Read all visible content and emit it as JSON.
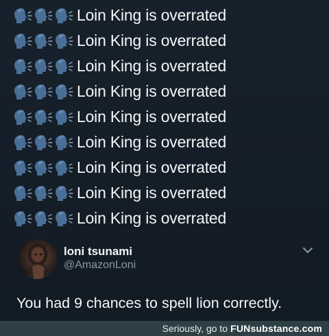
{
  "tweet": {
    "lines": [
      {
        "emojis": [
          "speaking-head-icon",
          "speaking-head-icon",
          "speaking-head-icon"
        ],
        "text": "Loin King is overrated"
      },
      {
        "emojis": [
          "speaking-head-icon",
          "speaking-head-icon",
          "speaking-head-icon"
        ],
        "text": "Loin King is overrated"
      },
      {
        "emojis": [
          "speaking-head-icon",
          "speaking-head-icon",
          "speaking-head-icon"
        ],
        "text": "Loin King is overrated"
      },
      {
        "emojis": [
          "speaking-head-icon",
          "speaking-head-icon",
          "speaking-head-icon"
        ],
        "text": "Loin King is overrated"
      },
      {
        "emojis": [
          "speaking-head-icon",
          "speaking-head-icon",
          "speaking-head-icon"
        ],
        "text": "Loin King is overrated"
      },
      {
        "emojis": [
          "speaking-head-icon",
          "speaking-head-icon",
          "speaking-head-icon"
        ],
        "text": "Loin King is overrated"
      },
      {
        "emojis": [
          "speaking-head-icon",
          "speaking-head-icon",
          "speaking-head-icon"
        ],
        "text": "Loin King is overrated"
      },
      {
        "emojis": [
          "speaking-head-icon",
          "speaking-head-icon",
          "speaking-head-icon"
        ],
        "text": "Loin King is overrated"
      },
      {
        "emojis": [
          "speaking-head-icon",
          "speaking-head-icon",
          "speaking-head-icon"
        ],
        "text": "Loin King is overrated"
      }
    ]
  },
  "reply": {
    "display_name": "loni tsunami",
    "handle": "@AmazonLoni",
    "text": "You had 9 chances to spell lion correctly.",
    "menu_icon": "chevron-down-icon"
  },
  "footer": {
    "prefix": "Seriously, go to",
    "brand_fun": "FUN",
    "brand_rest": "substance.com"
  },
  "colors": {
    "background": "#141d26",
    "text": "#f4f6f8",
    "muted": "#8899a6",
    "emoji": "#4a6f96",
    "footer_bg": "#2e4045"
  }
}
